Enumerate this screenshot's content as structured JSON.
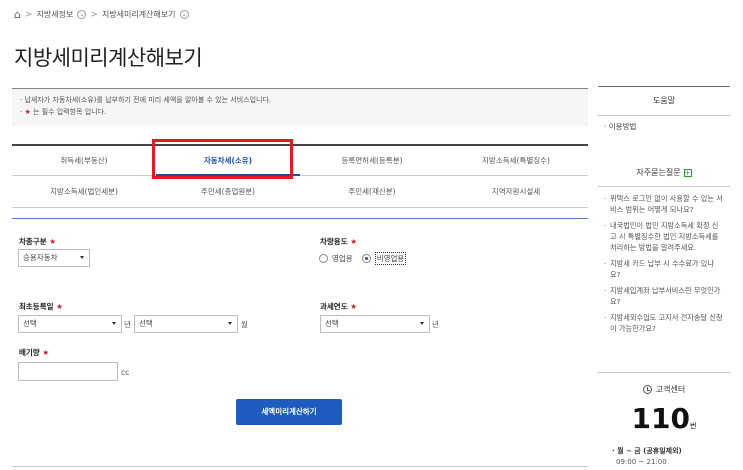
{
  "breadcrumb": {
    "home_icon": "home-icon",
    "items": [
      "지방세정보",
      "지방세미리계산해보기"
    ]
  },
  "page_title": "지방세미리계산해보기",
  "notice": {
    "line1": "· 납세자가 자동차세(소유)를 납부하기 전에 미리 세액을 알아볼 수 있는 서비스입니다.",
    "line2_prefix": "· ",
    "required_mark": "★",
    "line2_suffix": " 는 필수 입력항목 입니다."
  },
  "tabs": {
    "row1": [
      "취득세(부동산)",
      "자동차세(소유)",
      "등록면허세(등록분)",
      "지방소득세(특별징수)"
    ],
    "row2": [
      "지방소득세(법인세분)",
      "주민세(종업원분)",
      "주민세(재산분)",
      "지역자원시설세"
    ],
    "active": "자동차세(소유)"
  },
  "form": {
    "required_mark": "★",
    "vehicle_type": {
      "label": "차종구분",
      "value": "승용자동차"
    },
    "vehicle_use": {
      "label": "차량용도",
      "options": [
        "영업용",
        "비영업용"
      ],
      "selected": "비영업용"
    },
    "first_registration": {
      "label": "최초등록일",
      "year_value": "선택",
      "year_unit": "년",
      "month_value": "선택",
      "month_unit": "월"
    },
    "tax_year": {
      "label": "과세연도",
      "value": "선택",
      "unit": "년"
    },
    "displacement": {
      "label": "배기량",
      "value": "",
      "unit": "cc"
    },
    "submit_label": "세액미리계산하기"
  },
  "sidebar": {
    "help_title": "도움말",
    "usage_link": "· 이용방법",
    "faq_title": "자주묻는질문",
    "faq_items": [
      "위택스 로그인 없이 사용할 수 있는 서비스 범위는 어떻게 되나요?",
      "내국법인이 법인 지방소득세 확정 신고 시 특별징수한 법인 지방소득세를 처리하는 방법을 알려주세요.",
      "지방세 카드 납부 시 수수료가 있나요?",
      "지방세입계좌 납부서비스란 무엇인가요?",
      "지방세외수입도 고지서 전자송달 신청이 가능한가요?"
    ],
    "customer_center": {
      "title": "고객센터",
      "number": "110",
      "number_suffix": "번",
      "days": "· 월 ~ 금 (공휴일제외)",
      "hours": "09:00 ~ 21:00"
    }
  },
  "colors": {
    "accent": "#1d4fa8",
    "button": "#1e5cbd",
    "required": "#d21d2b",
    "highlight_box": "#e11a25"
  }
}
